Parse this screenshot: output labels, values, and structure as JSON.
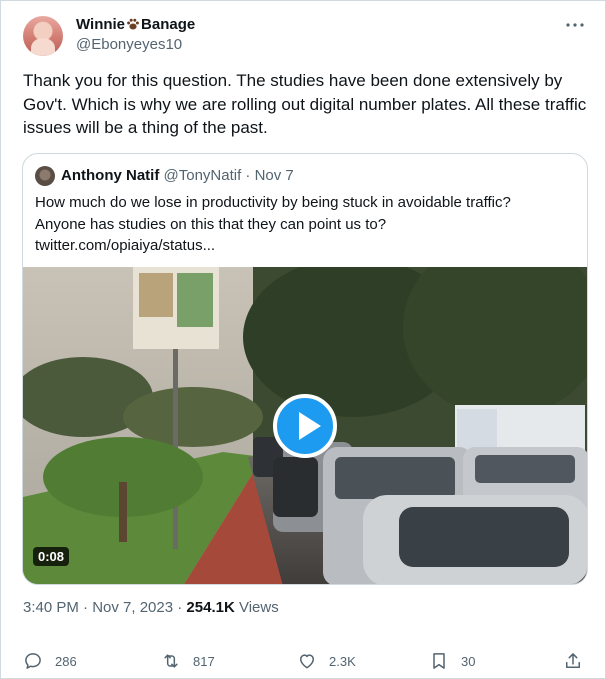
{
  "tweet": {
    "author_name_part1": "Winnie",
    "author_name_part2": "Banage",
    "author_handle": "@Ebonyeyes10",
    "text": "Thank you for this question. The studies have been done extensively by Gov't. Which is why we are rolling out digital number plates. All these traffic issues will be a thing of the past.",
    "time": "3:40 PM · Nov 7, 2023 · ",
    "views_count": "254.1K",
    "views_label": " Views"
  },
  "quote": {
    "author_name": "Anthony Natif",
    "meta": " @TonyNatif · Nov 7",
    "text_line1": "How much do we lose in productivity by being stuck in avoidable traffic?",
    "text_line2": "Anyone has studies on this that they can point us to?",
    "text_line3": "twitter.com/opiaiya/status...",
    "video_duration": "0:08"
  },
  "actions": {
    "replies": "286",
    "retweets": "817",
    "likes": "2.3K",
    "bookmarks": "30"
  },
  "colors": {
    "accent": "#1d9bf0",
    "secondary_text": "#536471",
    "border": "#cfd9de"
  },
  "icons": [
    "more-icon",
    "paw-emoji-icon",
    "play-icon",
    "reply-icon",
    "retweet-icon",
    "like-icon",
    "bookmark-icon",
    "share-icon"
  ]
}
